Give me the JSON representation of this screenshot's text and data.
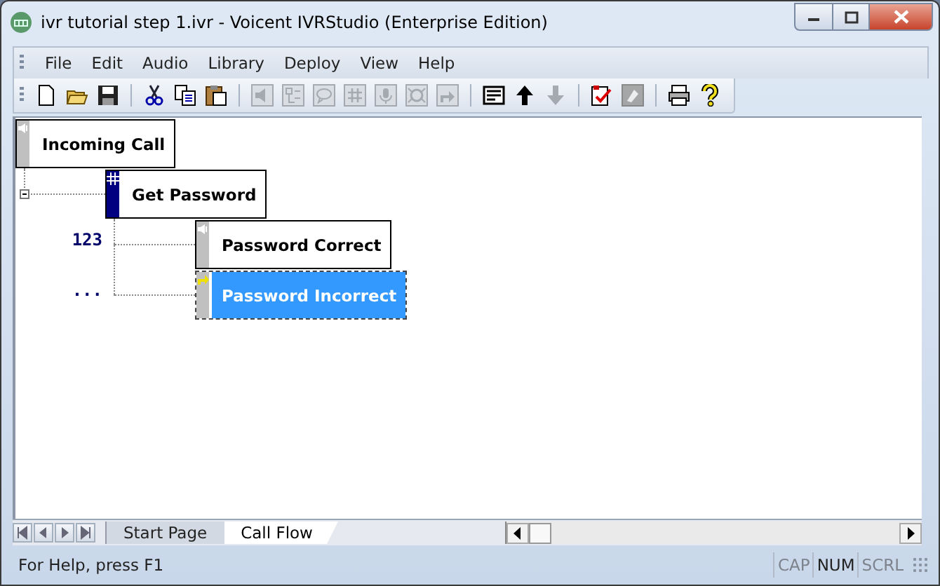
{
  "window": {
    "title": "ivr tutorial step 1.ivr - Voicent IVRStudio (Enterprise Edition)"
  },
  "menu": [
    "File",
    "Edit",
    "Audio",
    "Library",
    "Deploy",
    "View",
    "Help"
  ],
  "toolbar": [
    {
      "kind": "new",
      "disabled": false
    },
    {
      "kind": "open",
      "disabled": false
    },
    {
      "kind": "save",
      "disabled": false
    },
    {
      "kind": "separator"
    },
    {
      "kind": "cut",
      "disabled": false
    },
    {
      "kind": "copy",
      "disabled": false
    },
    {
      "kind": "paste",
      "disabled": false
    },
    {
      "kind": "separator"
    },
    {
      "kind": "audio",
      "disabled": true
    },
    {
      "kind": "menu",
      "disabled": true
    },
    {
      "kind": "speech",
      "disabled": true
    },
    {
      "kind": "hash",
      "disabled": true
    },
    {
      "kind": "record",
      "disabled": true
    },
    {
      "kind": "transfer",
      "disabled": true
    },
    {
      "kind": "goto",
      "disabled": true
    },
    {
      "kind": "separator"
    },
    {
      "kind": "properties",
      "disabled": false
    },
    {
      "kind": "up",
      "disabled": false
    },
    {
      "kind": "down",
      "disabled": true
    },
    {
      "kind": "separator"
    },
    {
      "kind": "check",
      "disabled": false
    },
    {
      "kind": "clear",
      "disabled": true
    },
    {
      "kind": "separator"
    },
    {
      "kind": "print",
      "disabled": false
    },
    {
      "kind": "help",
      "disabled": false
    }
  ],
  "flow": {
    "label": "Incoming Call",
    "kind": "audio",
    "selected": false,
    "children": [
      {
        "label": "Get Password",
        "kind": "hash",
        "selected": false,
        "children": [
          {
            "label": "Password Correct",
            "kind": "audio",
            "selected": false,
            "branch": "123"
          },
          {
            "label": "Password Incorrect",
            "kind": "goto",
            "selected": true,
            "branch": "..."
          }
        ]
      }
    ]
  },
  "sheet_tabs": [
    {
      "label": "Start Page",
      "selected": false
    },
    {
      "label": "Call Flow",
      "selected": true
    }
  ],
  "status_bar": {
    "text": "For Help, press F1",
    "indicators": [
      {
        "label": "CAP",
        "disabled": true
      },
      {
        "label": "NUM",
        "disabled": false
      },
      {
        "label": "SCRL",
        "disabled": true
      }
    ]
  }
}
